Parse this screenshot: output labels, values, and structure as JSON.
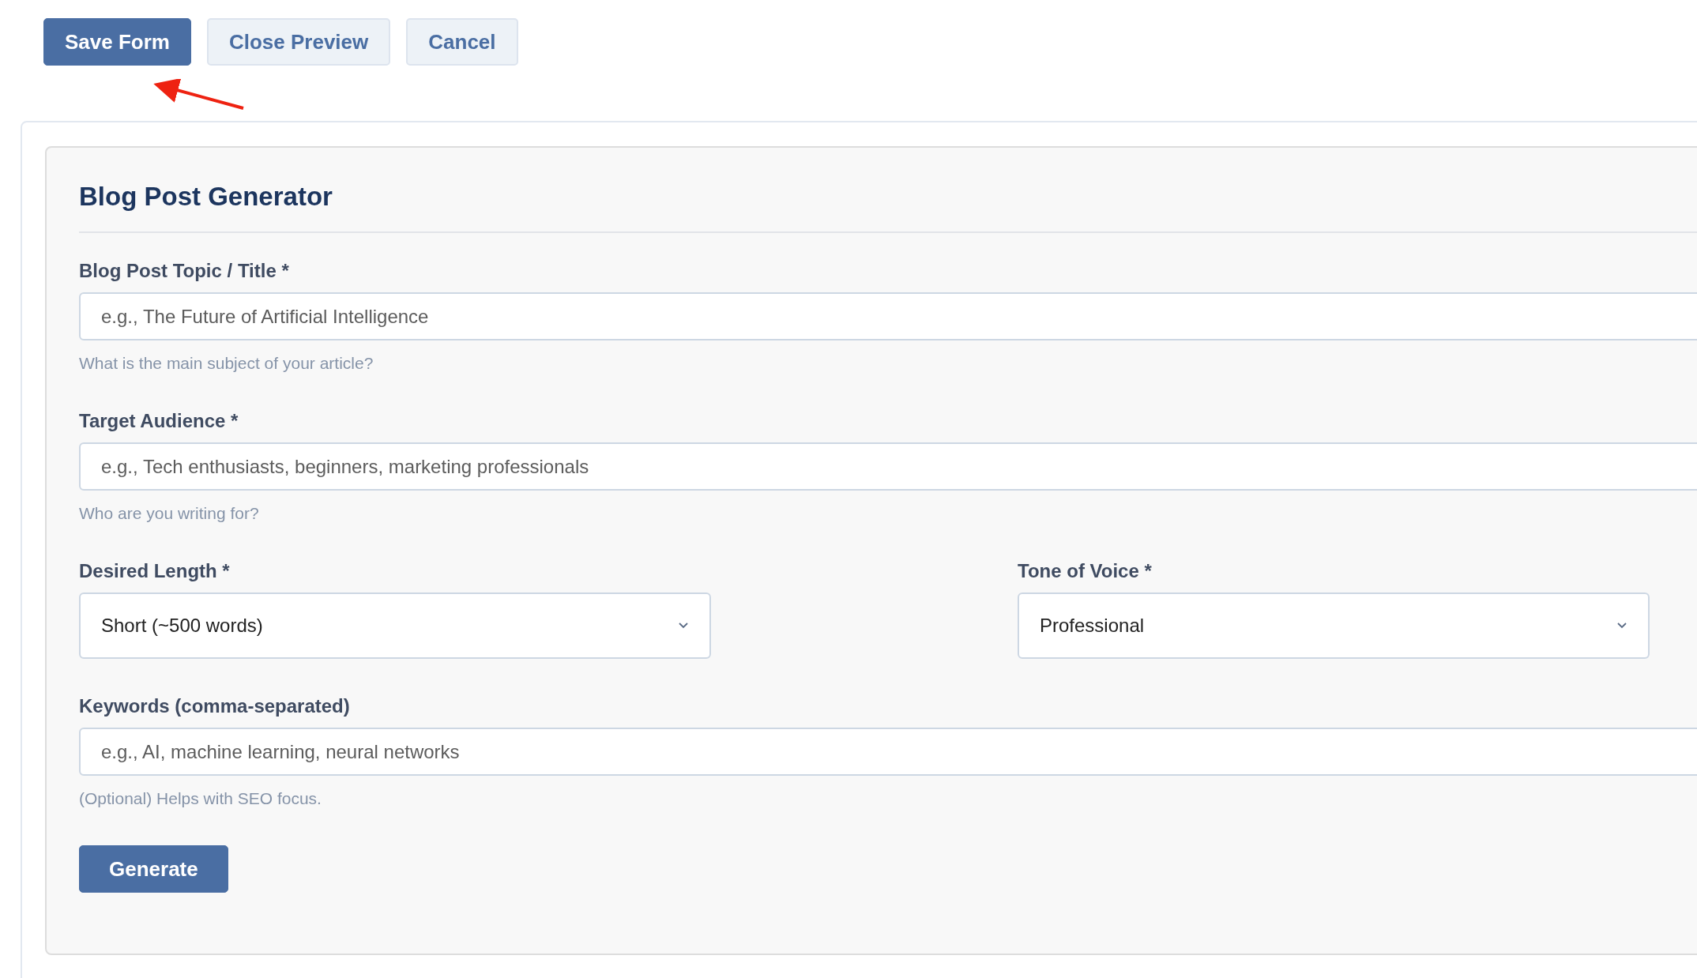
{
  "toolbar": {
    "buttons": [
      {
        "label": "Save Form",
        "kind": "primary"
      },
      {
        "label": "Close Preview",
        "kind": "secondary"
      },
      {
        "label": "Cancel",
        "kind": "secondary"
      }
    ]
  },
  "form": {
    "title": "Blog Post Generator",
    "rows": [
      [
        {
          "kind": "text",
          "label": "Blog Post Topic / Title *",
          "placeholder": "e.g., The Future of Artificial Intelligence",
          "help": "What is the main subject of your article?"
        }
      ],
      [
        {
          "kind": "text",
          "label": "Target Audience *",
          "placeholder": "e.g., Tech enthusiasts, beginners, marketing professionals",
          "help": "Who are you writing for?"
        }
      ],
      [
        {
          "kind": "select",
          "label": "Desired Length *",
          "value": "Short (~500 words)"
        },
        {
          "kind": "select",
          "label": "Tone of Voice *",
          "value": "Professional"
        }
      ],
      [
        {
          "kind": "text",
          "label": "Keywords (comma-separated)",
          "placeholder": "e.g., AI, machine learning, neural networks",
          "help": "(Optional) Helps with SEO focus."
        }
      ]
    ],
    "submit": "Generate"
  }
}
